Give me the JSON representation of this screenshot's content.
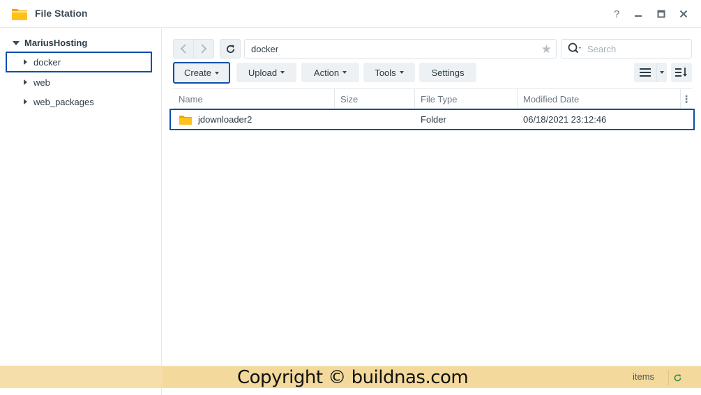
{
  "window": {
    "title": "File Station",
    "help_label": "?",
    "app_icon": "folder-app-icon"
  },
  "sidebar": {
    "root_label": "MariusHosting",
    "items": [
      {
        "label": "docker",
        "selected": true
      },
      {
        "label": "web",
        "selected": false
      },
      {
        "label": "web_packages",
        "selected": false
      }
    ]
  },
  "toolbar": {
    "path": "docker",
    "search_placeholder": "Search",
    "create_label": "Create",
    "upload_label": "Upload",
    "action_label": "Action",
    "tools_label": "Tools",
    "settings_label": "Settings"
  },
  "table": {
    "columns": [
      "Name",
      "Size",
      "File Type",
      "Modified Date"
    ],
    "rows": [
      {
        "name": "jdownloader2",
        "size": "",
        "type": "Folder",
        "modified": "06/18/2021 23:12:46"
      }
    ]
  },
  "statusbar": {
    "watermark": "Copyright © buildnas.com",
    "items_label": "items"
  },
  "colors": {
    "selection_border": "#0a4fa8",
    "folder": "#f5b800",
    "watermark_band": "#f3d99b"
  }
}
